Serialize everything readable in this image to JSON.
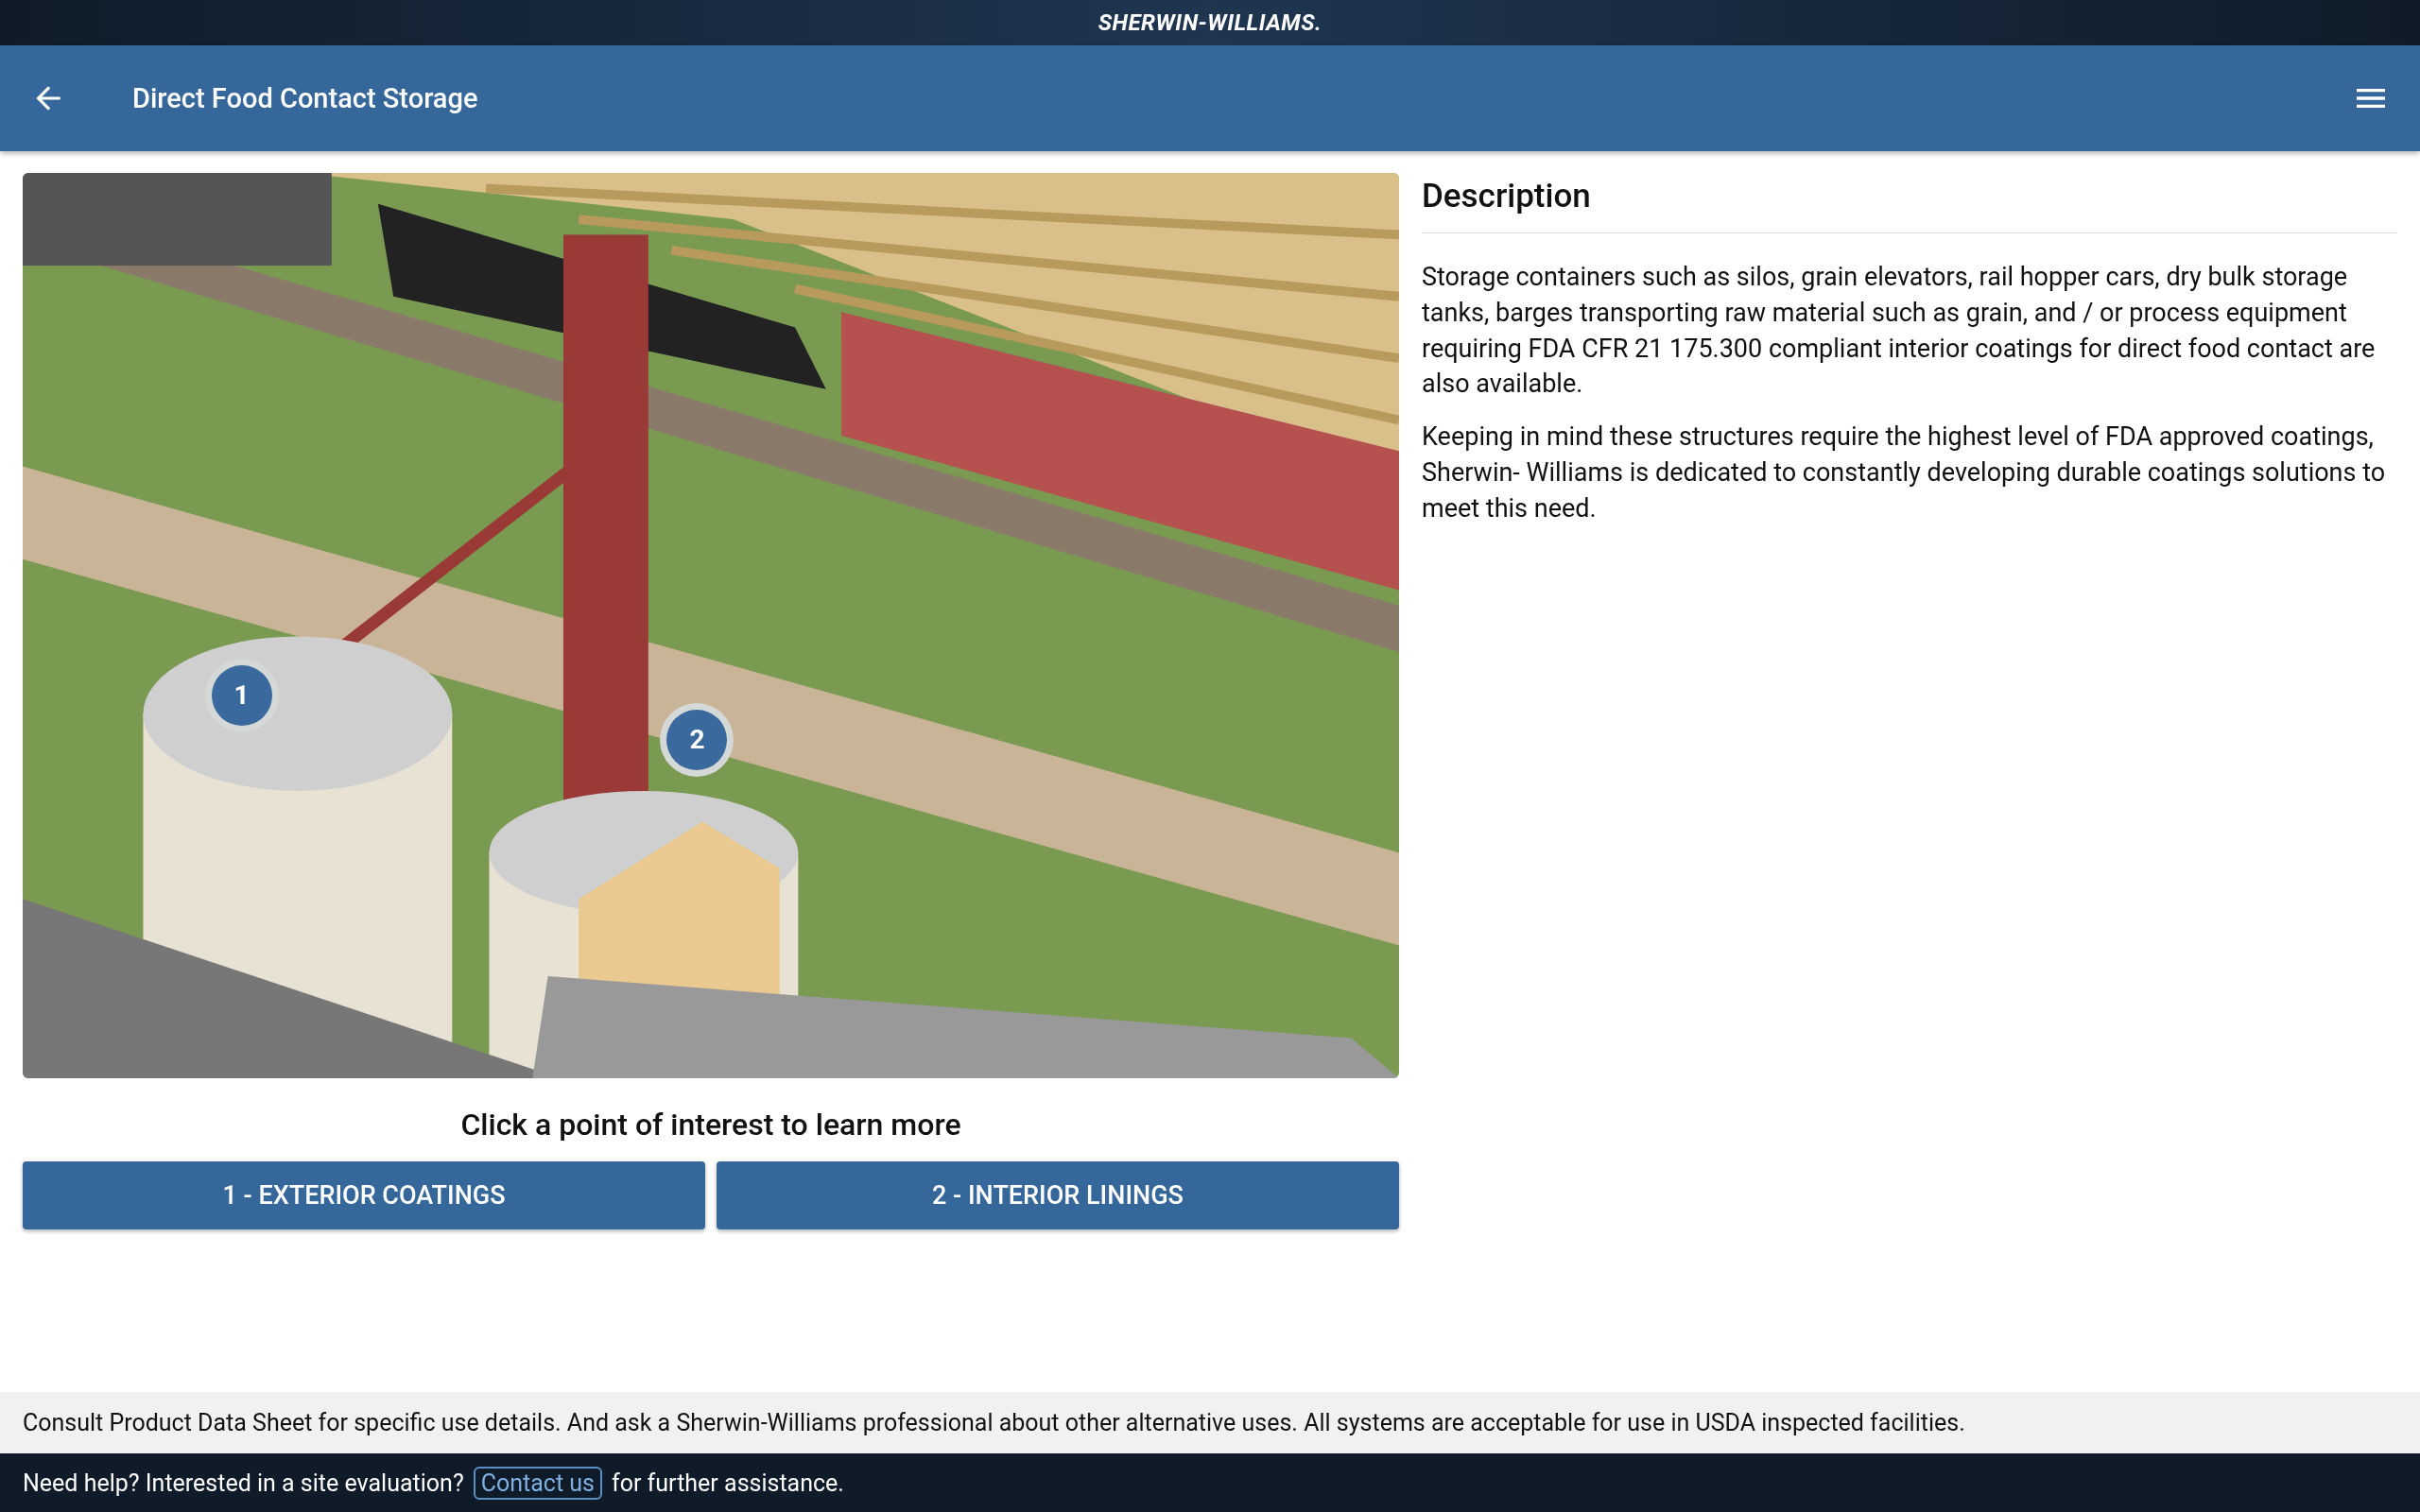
{
  "brand_bar": {
    "logo": "SHERWIN-WILLIAMS."
  },
  "app_bar": {
    "title": "Direct Food Contact Storage"
  },
  "illustration": {
    "hotspots": [
      {
        "label": "1"
      },
      {
        "label": "2"
      }
    ]
  },
  "caption": "Click a point of interest to learn more",
  "buttons": [
    "1 - EXTERIOR COATINGS",
    "2 - INTERIOR LININGS"
  ],
  "description": {
    "heading": "Description",
    "paragraphs": [
      "Storage containers such as silos, grain elevators, rail hopper cars, dry bulk storage tanks, barges transporting raw material such as grain, and / or process equipment requiring FDA CFR 21 175.300 compliant interior coatings for direct food contact are also available.",
      "Keeping in mind these structures require the highest level of FDA approved coatings, Sherwin- Williams is dedicated to constantly developing durable coatings solutions to meet this need."
    ]
  },
  "notice": "Consult Product Data Sheet for specific use details. And ask a Sherwin-Williams professional about other alternative uses. All systems are acceptable for use in USDA inspected facilities.",
  "help_bar": {
    "before": "Need help? Interested in a site evaluation?",
    "link": "Contact us",
    "after": "for further assistance."
  }
}
